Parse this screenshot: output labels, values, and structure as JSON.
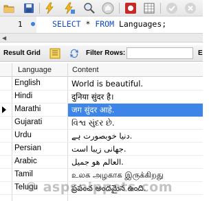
{
  "toolbar": {
    "buttons": [
      {
        "name": "open-folder-icon",
        "label": "Open"
      },
      {
        "name": "save-icon",
        "label": "Save"
      },
      {
        "name": "execute-icon",
        "label": "Execute"
      },
      {
        "name": "execute-current-icon",
        "label": "Execute current"
      },
      {
        "name": "explain-icon",
        "label": "Explain"
      },
      {
        "name": "stop-icon",
        "label": "Stop"
      },
      {
        "name": "error-toggle-icon",
        "label": "Toggle errors"
      },
      {
        "name": "grid-toggle-icon",
        "label": "Toggle grid"
      },
      {
        "name": "commit-icon",
        "label": "Commit"
      },
      {
        "name": "rollback-icon",
        "label": "Rollback"
      }
    ]
  },
  "editor": {
    "line_number": "1",
    "keyword_select": "SELECT",
    "star": " * ",
    "keyword_from": "FROM",
    "table_text": " Languages;"
  },
  "result_bar": {
    "label": "Result Grid",
    "filter_label": "Filter Rows:",
    "filter_value": "",
    "more_label": "E"
  },
  "grid": {
    "columns": [
      "Language",
      "Content"
    ],
    "selected_row": 2,
    "rows": [
      {
        "language": "English",
        "content": "World is beautiful."
      },
      {
        "language": "Hindi",
        "content": "दुनिया सुंदर है।"
      },
      {
        "language": "Marathi",
        "content": "जग सुंदर आहे."
      },
      {
        "language": "Gujarati",
        "content": "વિશ્વ સુંદર છે."
      },
      {
        "language": "Urdu",
        "content": "دنیا خوبصورت ہے."
      },
      {
        "language": "Persian",
        "content": "جهانی زیبا است."
      },
      {
        "language": "Arabic",
        "content": "العالم هو جميل."
      },
      {
        "language": "Tamil",
        "content": "உலக அழகாக இருக்கிறது"
      },
      {
        "language": "Telugu",
        "content": "ప్రపంచ అందమైన ఉంది."
      }
    ]
  },
  "watermark": "© aspsnippets.com",
  "colors": {
    "keyword": "#0d47c7",
    "selection": "#3d85e6",
    "line_dot": "#3f7fe0"
  }
}
